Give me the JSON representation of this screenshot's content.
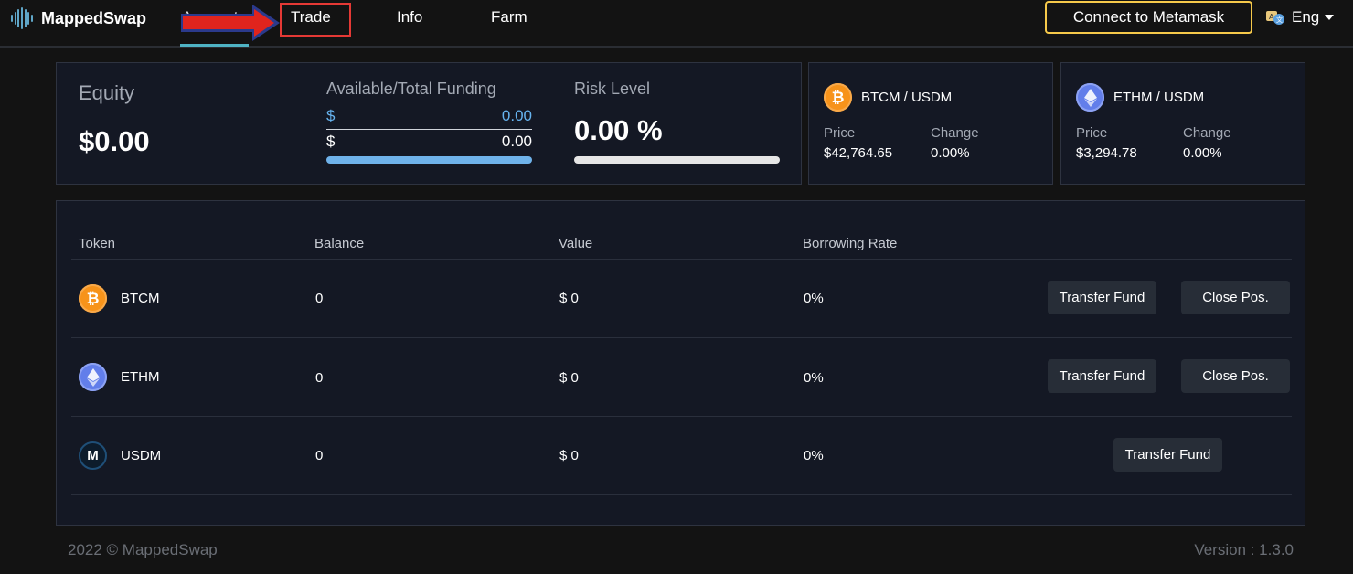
{
  "brand": {
    "name": "MappedSwap",
    "accent": "#4fb3c4"
  },
  "nav": {
    "links": [
      "Account",
      "Trade",
      "Info",
      "Farm"
    ],
    "active": "Account",
    "highlighted": "Trade",
    "connect_label": "Connect to Metamask",
    "language": "Eng"
  },
  "summary": {
    "equity_label": "Equity",
    "equity_value": "$0.00",
    "funding_label": "Available/Total Funding",
    "available_symbol": "$",
    "available_value": "0.00",
    "total_symbol": "$",
    "total_value": "0.00",
    "funding_progress": 1.0,
    "risk_label": "Risk Level",
    "risk_value": "0.00 %",
    "risk_progress": 0.0
  },
  "pairs": [
    {
      "name": "BTCM / USDM",
      "icon": "bitcoin-icon",
      "price_label": "Price",
      "price": "$42,764.65",
      "change_label": "Change",
      "change": "0.00%"
    },
    {
      "name": "ETHM / USDM",
      "icon": "ethereum-icon",
      "price_label": "Price",
      "price": "$3,294.78",
      "change_label": "Change",
      "change": "0.00%"
    }
  ],
  "table": {
    "headers": [
      "Token",
      "Balance",
      "Value",
      "Borrowing Rate"
    ],
    "rows": [
      {
        "token": "BTCM",
        "icon": "bitcoin-icon",
        "balance": "0",
        "value": "$ 0",
        "rate": "0%",
        "transfer_label": "Transfer Fund",
        "close_label": "Close Pos."
      },
      {
        "token": "ETHM",
        "icon": "ethereum-icon",
        "balance": "0",
        "value": "$ 0",
        "rate": "0%",
        "transfer_label": "Transfer Fund",
        "close_label": "Close Pos."
      },
      {
        "token": "USDM",
        "icon": "usdm-icon",
        "balance": "0",
        "value": "$ 0",
        "rate": "0%",
        "transfer_label": "Transfer Fund"
      }
    ]
  },
  "footer": {
    "copyright": "2022 © MappedSwap",
    "version": "Version : 1.3.0"
  }
}
